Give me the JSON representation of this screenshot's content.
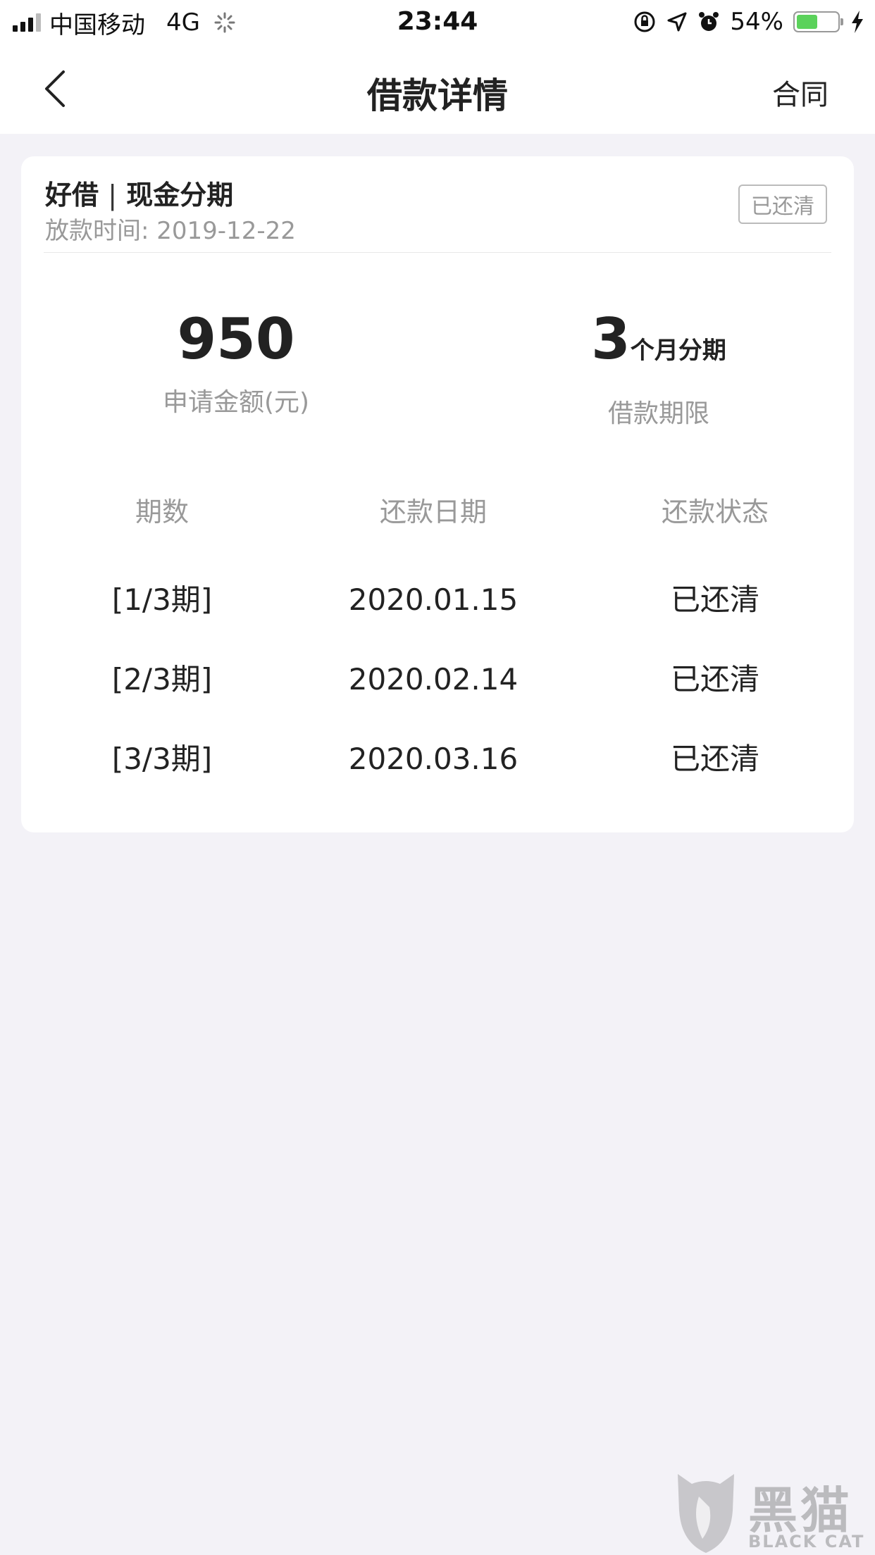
{
  "status_bar": {
    "carrier": "中国移动",
    "network": "4G",
    "time": "23:44",
    "battery_percent": "54%",
    "battery_level": 0.54
  },
  "nav": {
    "title": "借款详情",
    "contract_label": "合同"
  },
  "loan": {
    "product": "好借",
    "separator": "|",
    "type": "现金分期",
    "disburse_label": "放款时间: ",
    "disburse_date": "2019-12-22",
    "status_badge": "已还清",
    "amount_value": "950",
    "amount_label": "申请金额(元)",
    "term_value": "3",
    "term_unit": "个月分期",
    "term_label": "借款期限"
  },
  "schedule": {
    "headers": [
      "期数",
      "还款日期",
      "还款状态"
    ],
    "rows": [
      {
        "period": "[1/3期]",
        "date": "2020.01.15",
        "status": "已还清"
      },
      {
        "period": "[2/3期]",
        "date": "2020.02.14",
        "status": "已还清"
      },
      {
        "period": "[3/3期]",
        "date": "2020.03.16",
        "status": "已还清"
      }
    ]
  },
  "watermark": {
    "cn": "黑猫",
    "en": "BLACK CAT"
  }
}
